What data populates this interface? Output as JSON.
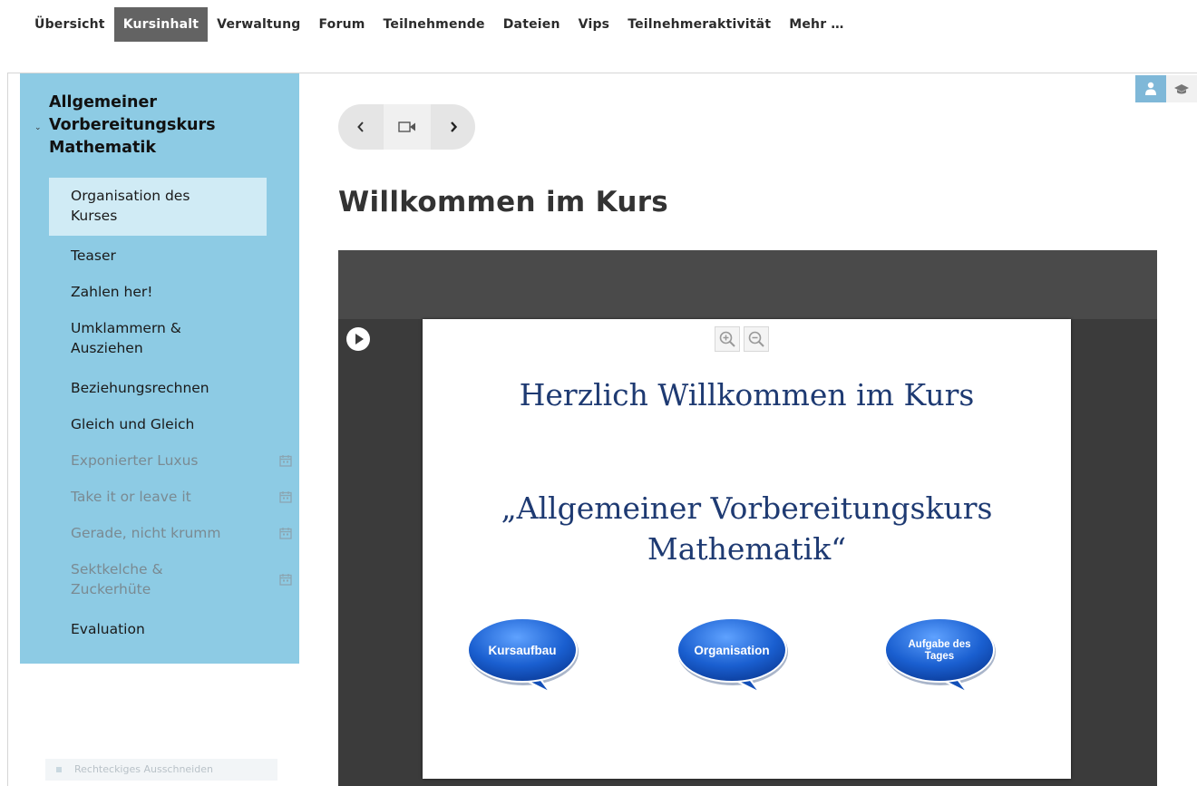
{
  "nav": {
    "tabs": [
      {
        "label": "Übersicht"
      },
      {
        "label": "Kursinhalt",
        "active": true
      },
      {
        "label": "Verwaltung"
      },
      {
        "label": "Forum"
      },
      {
        "label": "Teilnehmende"
      },
      {
        "label": "Dateien"
      },
      {
        "label": "Vips"
      },
      {
        "label": "Teilnehmeraktivität"
      },
      {
        "label": "Mehr …"
      }
    ]
  },
  "view_icons": [
    "person-icon",
    "graduation-cap-icon"
  ],
  "sidebar": {
    "title_line1": "Allgemeiner",
    "title_line2": "Vorbereitungskurs",
    "title_line3": "Mathematik",
    "items": [
      {
        "line1": "Organisation des",
        "line2": "Kurses",
        "active": true
      },
      {
        "label": "Teaser"
      },
      {
        "label": "Zahlen her!"
      },
      {
        "line1": "Umklammern &",
        "line2": "Ausziehen"
      },
      {
        "label": "Beziehungsrechnen"
      },
      {
        "label": "Gleich und Gleich"
      },
      {
        "label": "Exponierter Luxus",
        "locked": true
      },
      {
        "label": "Take it or leave it",
        "locked": true
      },
      {
        "label": "Gerade, nicht krumm",
        "locked": true
      },
      {
        "line1": "Sektkelche &",
        "line2": "Zuckerhüte",
        "locked": true
      },
      {
        "label": "Evaluation"
      }
    ]
  },
  "snip_tool_label": "Rechteckiges Ausschneiden",
  "main": {
    "page_title": "Willkommen im Kurs",
    "slide": {
      "title": "Herzlich Willkommen im Kurs",
      "subtitle_line1": "„Allgemeiner Vorbereitungskurs",
      "subtitle_line2": "Mathematik“",
      "bubble1": "Kursaufbau",
      "bubble2": "Organisation",
      "bubble3_line1": "Aufgabe des",
      "bubble3_line2": "Tages"
    }
  },
  "colors": {
    "sidebar_bg": "#8dcbe4",
    "sidebar_active": "#d0ebf5",
    "nav_active": "#636363",
    "player_bg": "#3b3b3b",
    "slide_text": "#1e3a72",
    "bubble": "#1a5fd0"
  }
}
